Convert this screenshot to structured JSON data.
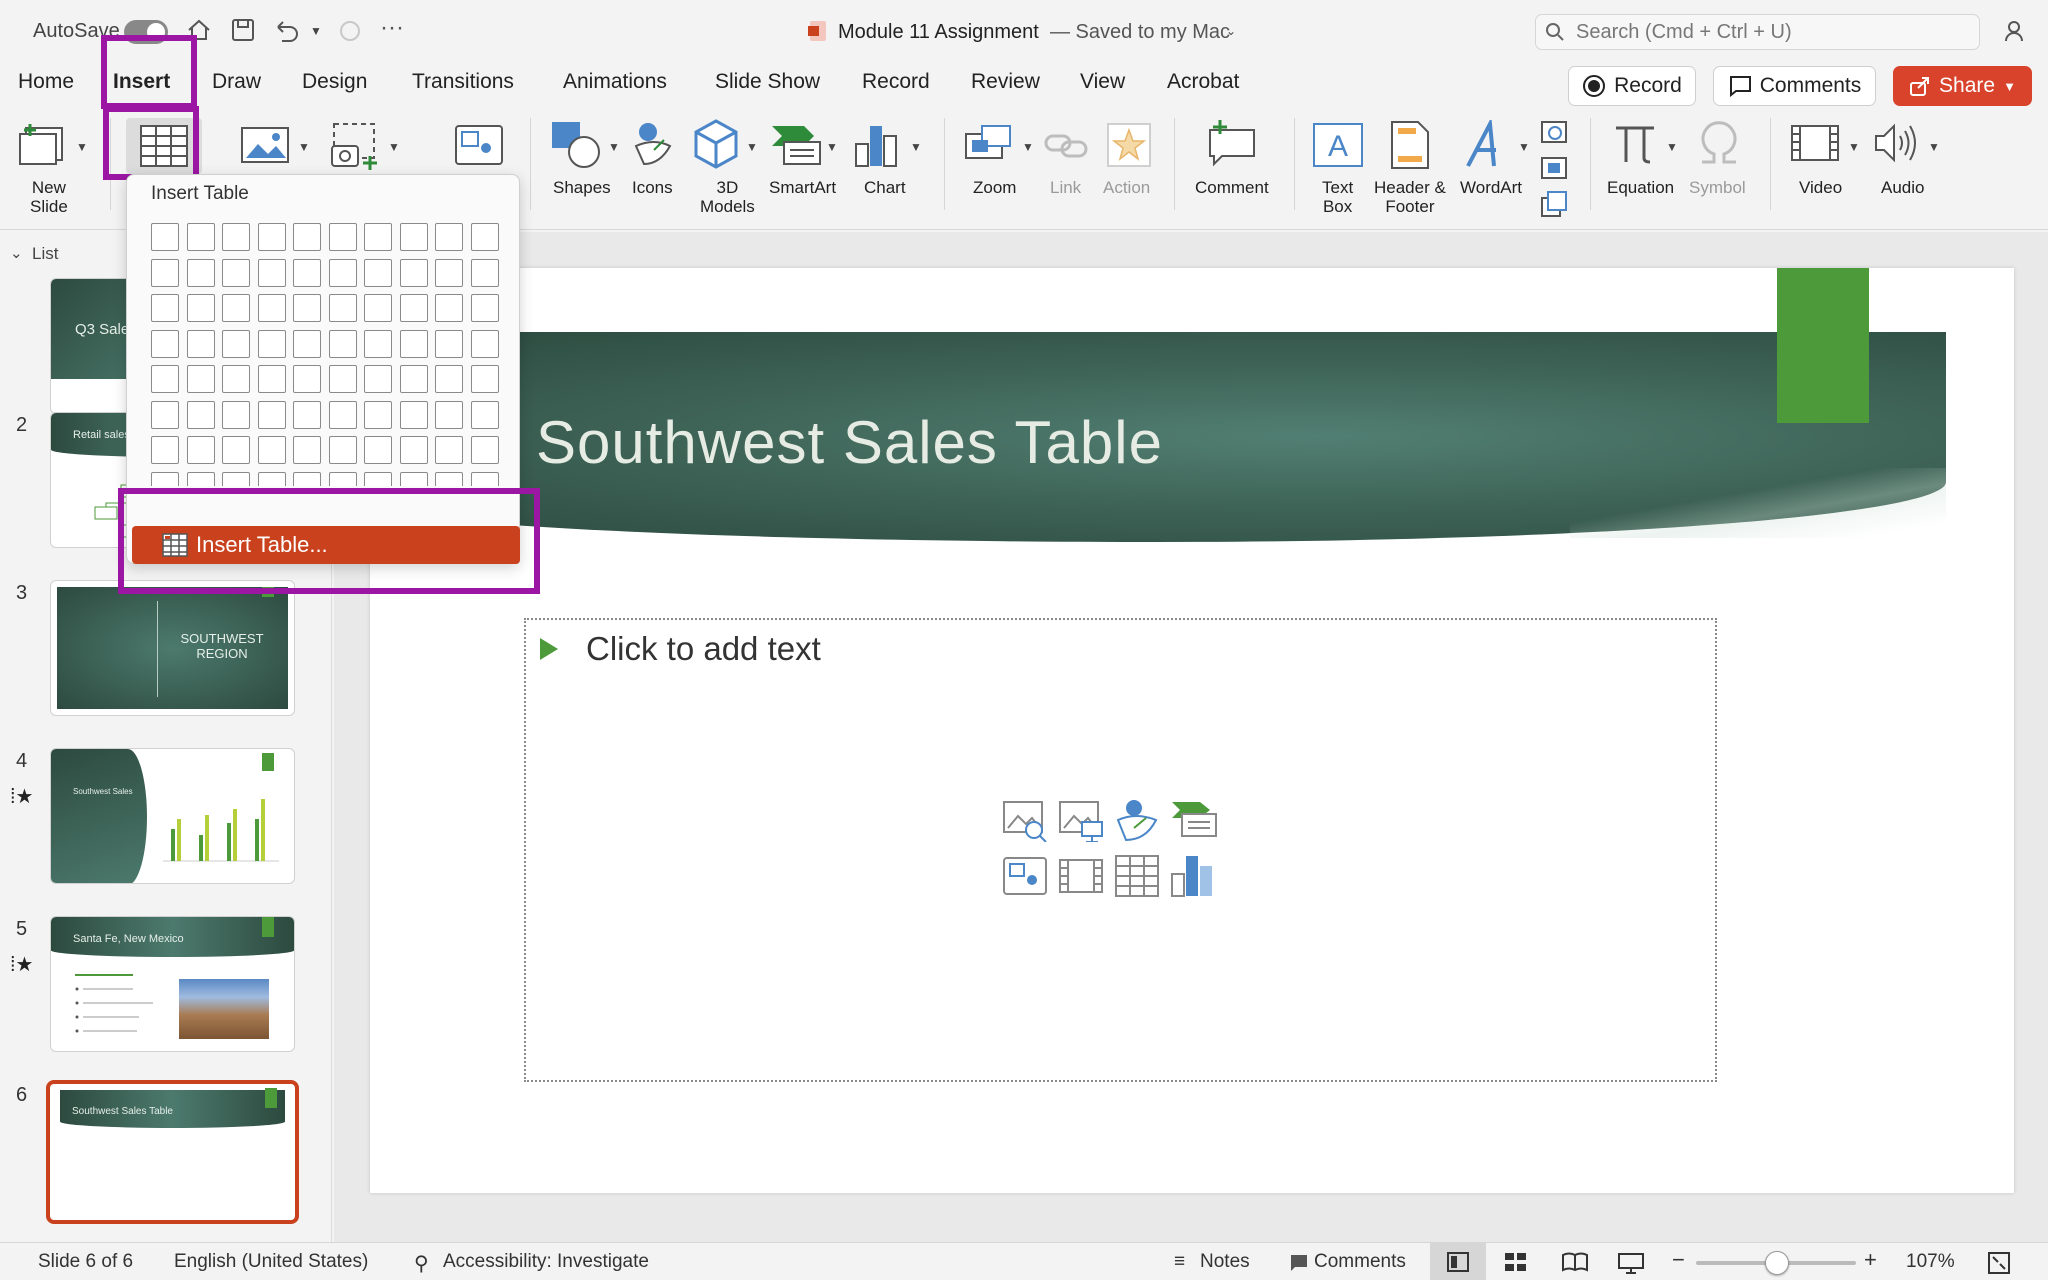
{
  "titlebar": {
    "autosave_label": "AutoSave",
    "doc_title": "Module 11 Assignment",
    "save_status": "— Saved to my Mac",
    "search_placeholder": "Search (Cmd + Ctrl + U)"
  },
  "tabs": [
    "Home",
    "Insert",
    "Draw",
    "Design",
    "Transitions",
    "Animations",
    "Slide Show",
    "Record",
    "Review",
    "View",
    "Acrobat"
  ],
  "active_tab": "Insert",
  "header_buttons": {
    "record": "Record",
    "comments": "Comments",
    "share": "Share"
  },
  "ribbon": {
    "new_slide": [
      "New",
      "Slide"
    ],
    "shapes": "Shapes",
    "icons": "Icons",
    "models": [
      "3D",
      "Models"
    ],
    "smartart": "SmartArt",
    "chart": "Chart",
    "zoom": "Zoom",
    "link": "Link",
    "action": "Action",
    "comment": "Comment",
    "textbox": [
      "Text",
      "Box"
    ],
    "header_footer": [
      "Header &",
      "Footer"
    ],
    "wordart": "WordArt",
    "equation": "Equation",
    "symbol": "Symbol",
    "video": "Video",
    "audio": "Audio"
  },
  "dropdown": {
    "title": "Insert Table",
    "item_label": "Insert Table...",
    "grid_cols": 10,
    "grid_rows": 8
  },
  "pane": {
    "header": "List"
  },
  "slides": [
    {
      "num": "",
      "title": "Q3 Sale"
    },
    {
      "num": "2",
      "title": "Retail sales"
    },
    {
      "num": "3",
      "title": "SOUTHWEST REGION"
    },
    {
      "num": "4",
      "title": "Southwest Sales"
    },
    {
      "num": "5",
      "title": "Santa Fe, New Mexico"
    },
    {
      "num": "6",
      "title": "Southwest Sales Table"
    }
  ],
  "slide": {
    "title": "Southwest Sales Table",
    "placeholder": "Click to add text"
  },
  "statusbar": {
    "slide_count": "Slide 6 of 6",
    "language": "English (United States)",
    "accessibility": "Accessibility: Investigate",
    "notes": "Notes",
    "comments": "Comments",
    "zoom": "107%"
  },
  "colors": {
    "accent": "#d9432b",
    "highlight": "#9b16a3",
    "slide_green": "#4c9a3a",
    "band": "#3f6558"
  }
}
